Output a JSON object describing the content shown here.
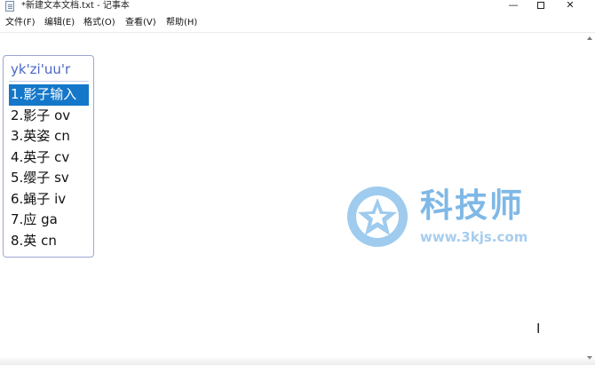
{
  "window": {
    "title": "*新建文本文档.txt - 记事本",
    "minimize_glyph": "—",
    "close_glyph": "✕"
  },
  "menu": {
    "items": [
      "文件(F)",
      "编辑(E)",
      "格式(O)",
      "查看(V)",
      "帮助(H)"
    ]
  },
  "ime": {
    "composition": "yk'zi'uu'r",
    "candidates": [
      "1.影子输入",
      "2.影子 ov",
      "3.英姿 cn",
      "4.英子 cv",
      "5.缨子 sv",
      "6.蝇子 iv",
      "7.应 ga",
      "8.英 cn"
    ],
    "selected_index": 0
  },
  "watermark": {
    "title": "科技师",
    "url": "www.3kjs.com",
    "color": "#7fb8e6"
  },
  "cursor": {
    "glyph": "I"
  }
}
